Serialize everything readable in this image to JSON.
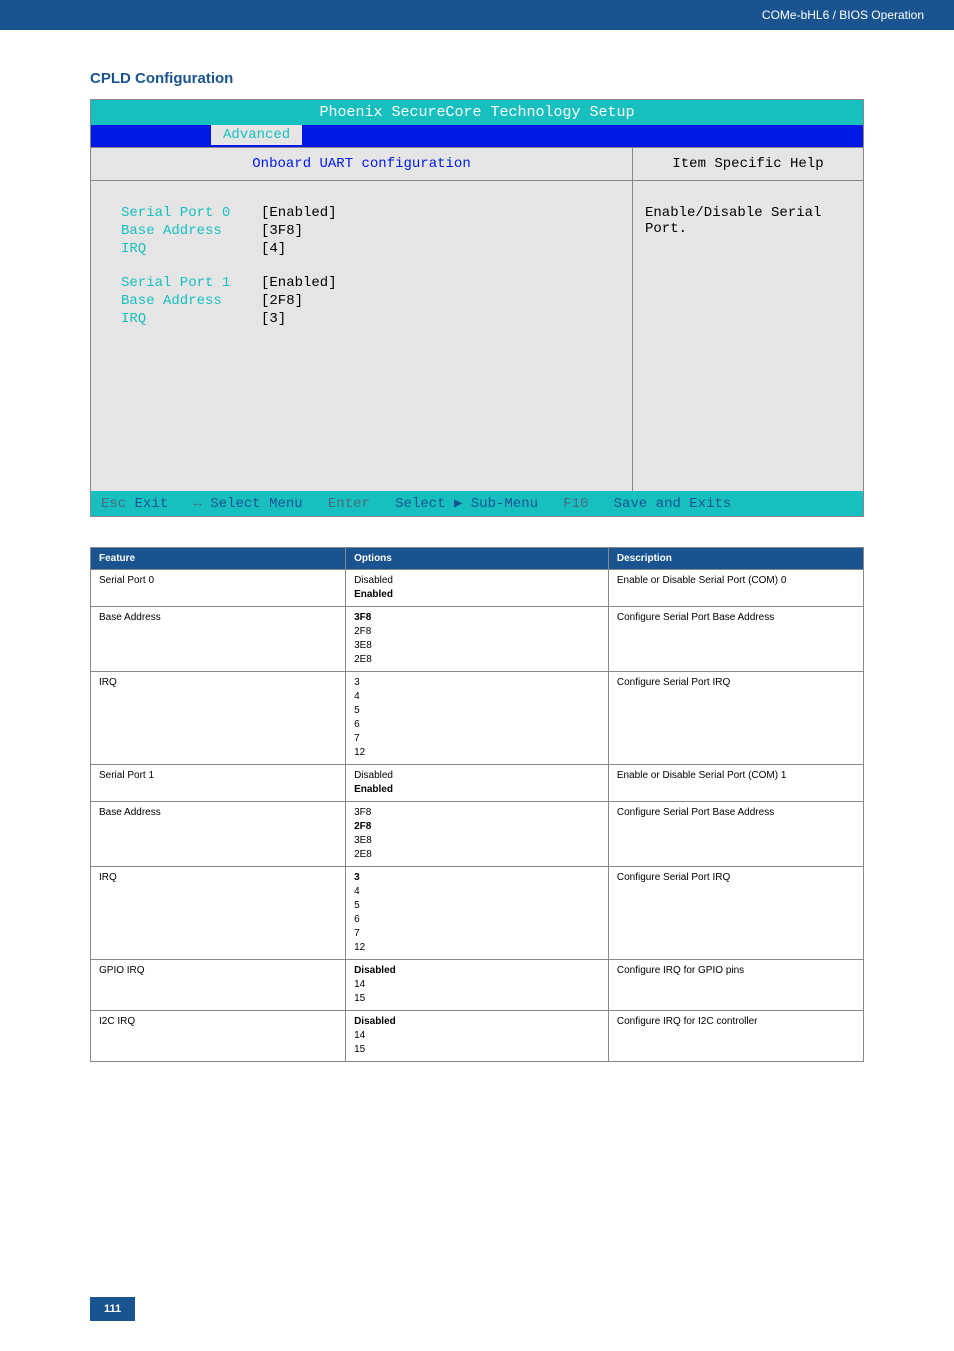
{
  "header": {
    "breadcrumb": "COMe-bHL6 / BIOS Operation"
  },
  "section_title": "CPLD Configuration",
  "bios": {
    "title": "Phoenix SecureCore Technology Setup",
    "tab": "Advanced",
    "subtitle": "Onboard UART configuration",
    "help_title": "Item Specific Help",
    "help_text": "Enable/Disable Serial Port.",
    "groups": [
      {
        "rows": [
          {
            "label": "Serial Port 0",
            "value": "[Enabled]"
          },
          {
            "label": "Base Address",
            "value": "[3F8]"
          },
          {
            "label": "IRQ",
            "value": "[4]"
          }
        ]
      },
      {
        "rows": [
          {
            "label": "Serial Port 1",
            "value": "[Enabled]"
          },
          {
            "label": "Base Address",
            "value": "[2F8]"
          },
          {
            "label": "IRQ",
            "value": "[3]"
          }
        ]
      }
    ],
    "footer": {
      "esc": "Esc",
      "exit": "Exit",
      "arrows": "↔",
      "select_menu": "Select Menu",
      "enter": "Enter",
      "select_sub": "Select ▶ Sub-Menu",
      "f10": "F10",
      "save": "Save and Exits"
    }
  },
  "table": {
    "headers": {
      "feature": "Feature",
      "options": "Options",
      "description": "Description"
    },
    "rows": [
      {
        "feature": "Serial Port 0",
        "options": [
          {
            "text": "Disabled",
            "bold": false
          },
          {
            "text": "Enabled",
            "bold": true
          }
        ],
        "description": "Enable or Disable Serial Port (COM) 0"
      },
      {
        "feature": "Base Address",
        "options": [
          {
            "text": "3F8",
            "bold": true
          },
          {
            "text": "2F8",
            "bold": false
          },
          {
            "text": "3E8",
            "bold": false
          },
          {
            "text": "2E8",
            "bold": false
          }
        ],
        "description": "Configure Serial Port Base Address"
      },
      {
        "feature": "IRQ",
        "options": [
          {
            "text": "3",
            "bold": false
          },
          {
            "text": "4",
            "bold": false
          },
          {
            "text": "5",
            "bold": false
          },
          {
            "text": "6",
            "bold": false
          },
          {
            "text": "7",
            "bold": false
          },
          {
            "text": "12",
            "bold": false
          }
        ],
        "description": "Configure Serial Port IRQ"
      },
      {
        "feature": "Serial Port 1",
        "options": [
          {
            "text": "Disabled",
            "bold": false
          },
          {
            "text": "Enabled",
            "bold": true
          }
        ],
        "description": "Enable or Disable Serial Port (COM) 1"
      },
      {
        "feature": "Base Address",
        "options": [
          {
            "text": "3F8",
            "bold": false
          },
          {
            "text": "2F8",
            "bold": true
          },
          {
            "text": "3E8",
            "bold": false
          },
          {
            "text": "2E8",
            "bold": false
          }
        ],
        "description": "Configure Serial Port Base Address"
      },
      {
        "feature": "IRQ",
        "options": [
          {
            "text": "3",
            "bold": true
          },
          {
            "text": "4",
            "bold": false
          },
          {
            "text": "5",
            "bold": false
          },
          {
            "text": "6",
            "bold": false
          },
          {
            "text": "7",
            "bold": false
          },
          {
            "text": "12",
            "bold": false
          }
        ],
        "description": "Configure Serial Port IRQ"
      },
      {
        "feature": "GPIO IRQ",
        "options": [
          {
            "text": "Disabled",
            "bold": true
          },
          {
            "text": "14",
            "bold": false
          },
          {
            "text": "15",
            "bold": false
          }
        ],
        "description": "Configure IRQ for GPIO pins"
      },
      {
        "feature": "I2C IRQ",
        "options": [
          {
            "text": "Disabled",
            "bold": true
          },
          {
            "text": "14",
            "bold": false
          },
          {
            "text": "15",
            "bold": false
          }
        ],
        "description": "Configure IRQ for I2C controller"
      }
    ]
  },
  "page_number": "111"
}
